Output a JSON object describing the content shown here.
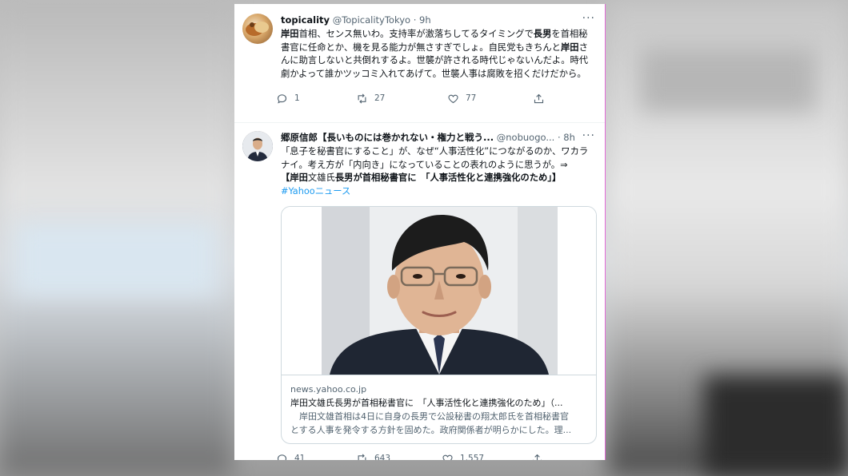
{
  "tweets": [
    {
      "display_name": "topicality",
      "handle": "@TopicalityTokyo",
      "dot": "·",
      "time": "9h",
      "more": "···",
      "text_parts": [
        {
          "t": "岸田",
          "b": true
        },
        {
          "t": "首相、センス無いわ。支持率が激落ちしてるタイミングで",
          "b": false
        },
        {
          "t": "長男",
          "b": true
        },
        {
          "t": "を首相秘書官に任命とか、機を見る能力が無さすぎでしょ。自民党もきちんと",
          "b": false
        },
        {
          "t": "岸田",
          "b": true
        },
        {
          "t": "さんに助言しないと共倒れするよ。世襲が許される時代じゃないんだよ。時代劇かよって誰かツッコミ入れてあげて。世襲人事は腐敗を招くだけだから。",
          "b": false
        }
      ],
      "replies": "1",
      "retweets": "27",
      "likes": "77"
    },
    {
      "display_name": "郷原信郎【長いものには巻かれない・権力と戦う...",
      "handle": "@nobuogo...",
      "dot": "·",
      "time": "8h",
      "more": "···",
      "text_parts": [
        {
          "t": "「息子を秘書官にすること」が、なぜ“人事活性化”につながるのか、ワカラナイ。考え方が「内向き」になっていることの表れのように思うが。⇒",
          "b": false
        },
        {
          "t": "【",
          "b": true
        },
        {
          "t": "岸田",
          "b": true
        },
        {
          "t": "文雄氏",
          "b": false
        },
        {
          "t": "長男",
          "b": true
        },
        {
          "t": "が首相秘書官に　「人事活性化と連携強化のため」】",
          "b": true
        }
      ],
      "hashtag": "#Yahooニュース",
      "card": {
        "domain": "news.yahoo.co.jp",
        "title": "岸田文雄氏長男が首相秘書官に　「人事活性化と連携強化のため」（...",
        "desc_line1": "　岸田文雄首相は4日に自身の長男で公設秘書の翔太郎氏を首相秘書官",
        "desc_line2": "とする人事を発令する方針を固めた。政府関係者が明らかにした。理..."
      },
      "replies": "41",
      "retweets": "643",
      "likes": "1,557"
    }
  ],
  "icons": [
    "reply-icon",
    "retweet-icon",
    "like-icon",
    "share-icon",
    "more-icon"
  ],
  "colors": {
    "accent": "#1d9bf0",
    "text": "#0f1419",
    "muted": "#536471"
  }
}
